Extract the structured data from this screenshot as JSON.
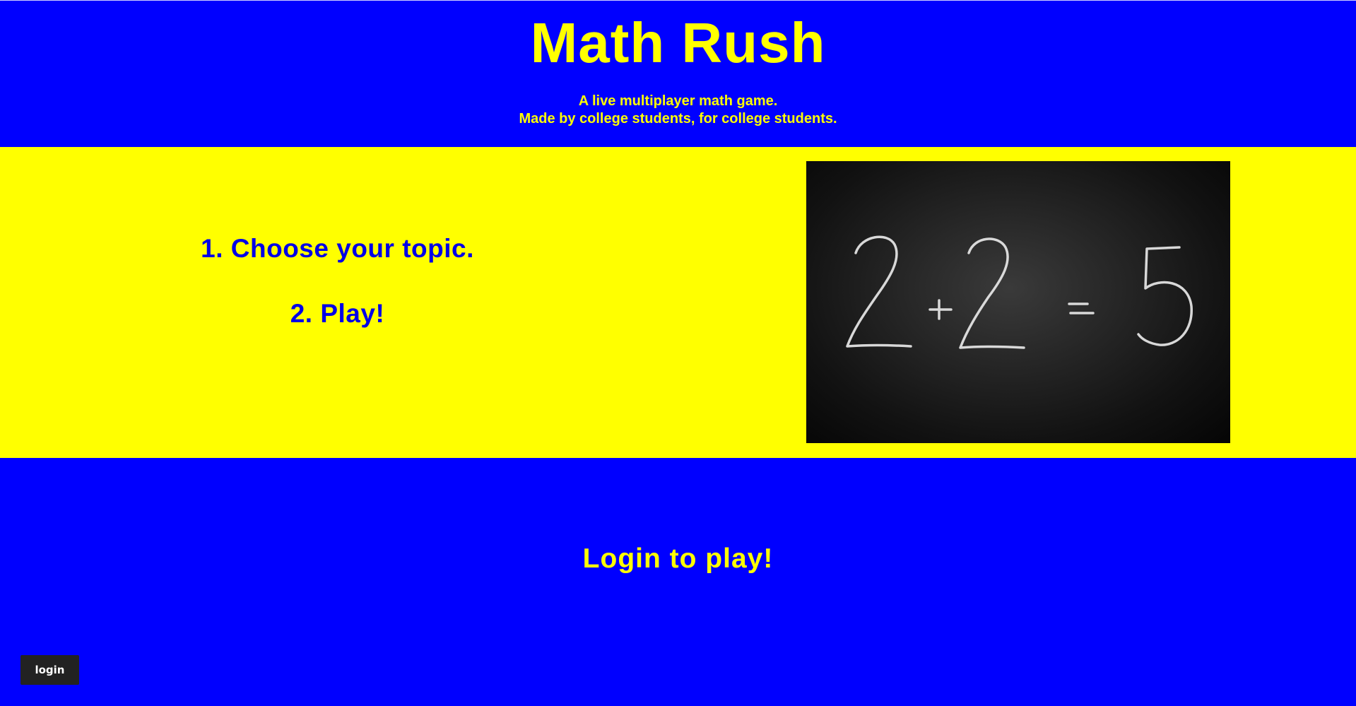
{
  "header": {
    "title": "Math Rush",
    "tagline_line1": "A live multiplayer math game.",
    "tagline_line2": "Made by college students, for college students."
  },
  "steps": [
    {
      "label": "1. Choose your topic."
    },
    {
      "label": "2. Play!"
    }
  ],
  "hero_image": {
    "depicts": "chalkboard-equation"
  },
  "cta": {
    "prompt": "Login to play!"
  },
  "login_button": {
    "label": "login"
  },
  "colors": {
    "primary_blue": "#0000ff",
    "accent_yellow": "#ffff00",
    "step_text_blue": "#0000e6",
    "button_dark": "#222222"
  }
}
